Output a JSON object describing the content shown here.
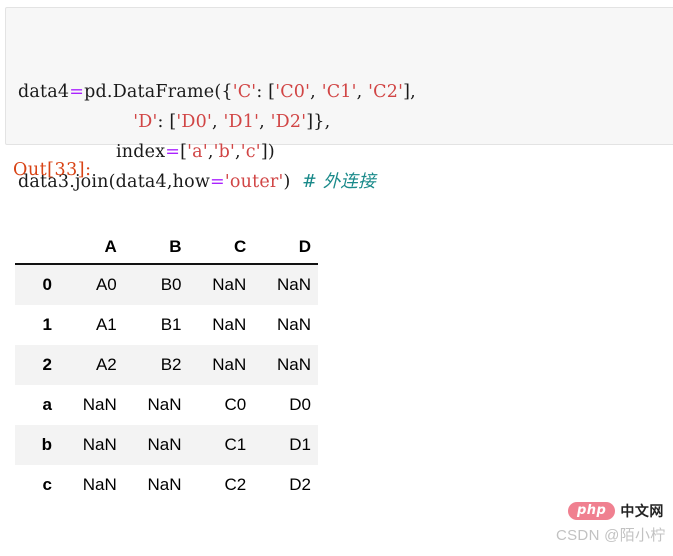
{
  "code_cell": {
    "name": "jupyter-code-cell",
    "lines": [
      [
        {
          "t": "data4",
          "c": "plain"
        },
        {
          "t": "=",
          "c": "op"
        },
        {
          "t": "pd.DataFrame({",
          "c": "plain"
        },
        {
          "t": "'C'",
          "c": "str"
        },
        {
          "t": ": [",
          "c": "plain"
        },
        {
          "t": "'C0'",
          "c": "str"
        },
        {
          "t": ", ",
          "c": "plain"
        },
        {
          "t": "'C1'",
          "c": "str"
        },
        {
          "t": ", ",
          "c": "plain"
        },
        {
          "t": "'C2'",
          "c": "str"
        },
        {
          "t": "],",
          "c": "plain"
        }
      ],
      [
        {
          "t": "                    ",
          "c": "plain"
        },
        {
          "t": "'D'",
          "c": "str"
        },
        {
          "t": ": [",
          "c": "plain"
        },
        {
          "t": "'D0'",
          "c": "str"
        },
        {
          "t": ", ",
          "c": "plain"
        },
        {
          "t": "'D1'",
          "c": "str"
        },
        {
          "t": ", ",
          "c": "plain"
        },
        {
          "t": "'D2'",
          "c": "str"
        },
        {
          "t": "]},",
          "c": "plain"
        }
      ],
      [
        {
          "t": "                 index",
          "c": "plain"
        },
        {
          "t": "=",
          "c": "op"
        },
        {
          "t": "[",
          "c": "plain"
        },
        {
          "t": "'a'",
          "c": "str"
        },
        {
          "t": ",",
          "c": "plain"
        },
        {
          "t": "'b'",
          "c": "str"
        },
        {
          "t": ",",
          "c": "plain"
        },
        {
          "t": "'c'",
          "c": "str"
        },
        {
          "t": "])",
          "c": "plain"
        }
      ],
      [
        {
          "t": "data3.join(data4,how",
          "c": "plain"
        },
        {
          "t": "=",
          "c": "op"
        },
        {
          "t": "'outer'",
          "c": "str"
        },
        {
          "t": ")  ",
          "c": "plain"
        },
        {
          "t": "# 外连接",
          "c": "cmt"
        }
      ]
    ],
    "plain_text": "data4=pd.DataFrame({'C':['C0','C1','C2'],\n                    'D':['D0','D1','D2']},\n                 index=['a','b','c'])\ndata3.join(data4,how='outer')  # 外连接"
  },
  "output": {
    "prompt": "Out[33]:"
  },
  "dataframe": {
    "index_header": "",
    "columns": [
      "A",
      "B",
      "C",
      "D"
    ],
    "rows": [
      {
        "index": "0",
        "cells": [
          "A0",
          "B0",
          "NaN",
          "NaN"
        ],
        "striped": true
      },
      {
        "index": "1",
        "cells": [
          "A1",
          "B1",
          "NaN",
          "NaN"
        ],
        "striped": false
      },
      {
        "index": "2",
        "cells": [
          "A2",
          "B2",
          "NaN",
          "NaN"
        ],
        "striped": true
      },
      {
        "index": "a",
        "cells": [
          "NaN",
          "NaN",
          "C0",
          "D0"
        ],
        "striped": false
      },
      {
        "index": "b",
        "cells": [
          "NaN",
          "NaN",
          "C1",
          "D1"
        ],
        "striped": true
      },
      {
        "index": "c",
        "cells": [
          "NaN",
          "NaN",
          "C2",
          "D2"
        ],
        "striped": false
      }
    ]
  },
  "watermark": {
    "logo_text": "php",
    "logo_suffix": "中文网",
    "attribution": "CSDN @陌小柠"
  },
  "colors": {
    "cell_background": "#f7f7f7",
    "cell_border": "#e3e3e3",
    "string_token": "#d14545",
    "operator_token": "#aa22ff",
    "comment_token": "#1a8a8a",
    "out_prompt": "#d84315",
    "row_stripe": "#f3f3f3",
    "watermark_pill": "#f08090",
    "watermark_text": "#c2c2c2"
  }
}
